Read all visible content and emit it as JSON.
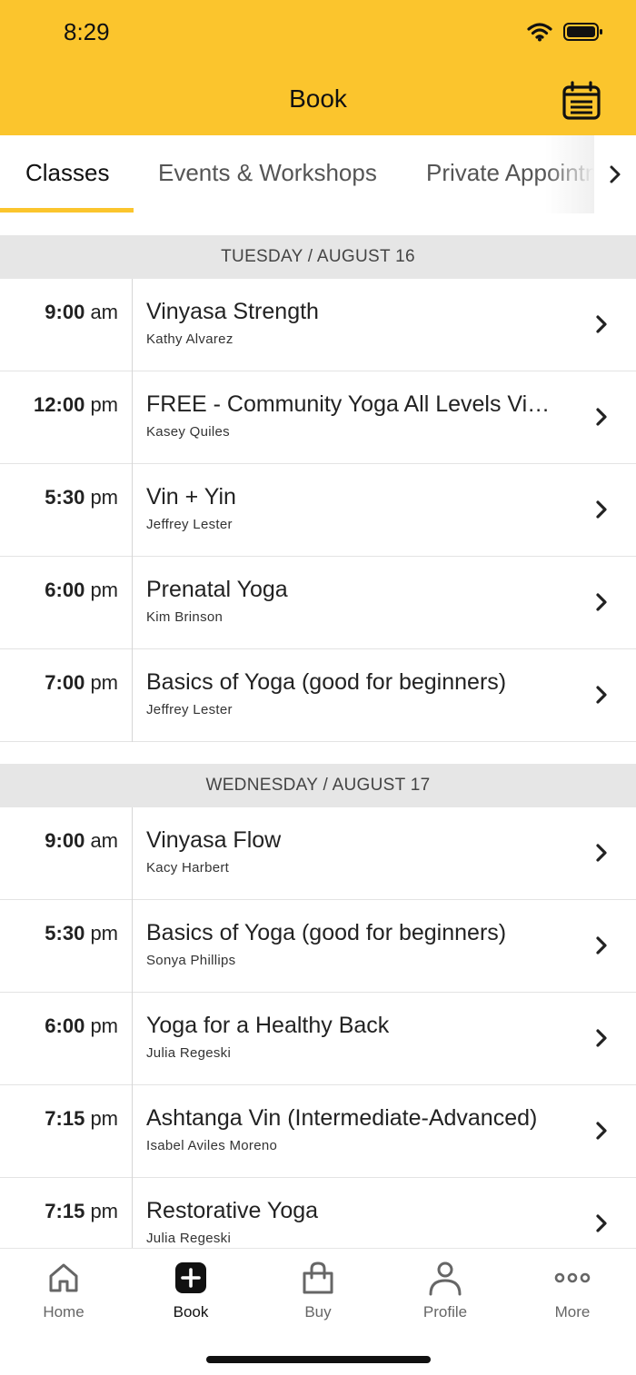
{
  "status": {
    "time": "8:29"
  },
  "header": {
    "title": "Book",
    "calendar_icon": "calendar-icon"
  },
  "tabs": [
    {
      "label": "Classes",
      "active": true
    },
    {
      "label": "Events & Workshops",
      "active": false
    },
    {
      "label": "Private Appointments",
      "active": false
    }
  ],
  "days": [
    {
      "header": "TUESDAY / AUGUST 16",
      "classes": [
        {
          "time": "9:00",
          "ampm": "am",
          "title": "Vinyasa Strength",
          "instructor": "Kathy Alvarez"
        },
        {
          "time": "12:00",
          "ampm": "pm",
          "title": "FREE - Community Yoga All Levels Vi…",
          "instructor": "Kasey Quiles"
        },
        {
          "time": "5:30",
          "ampm": "pm",
          "title": "Vin + Yin",
          "instructor": "Jeffrey Lester"
        },
        {
          "time": "6:00",
          "ampm": "pm",
          "title": "Prenatal Yoga",
          "instructor": "Kim Brinson"
        },
        {
          "time": "7:00",
          "ampm": "pm",
          "title": "Basics of Yoga (good for beginners)",
          "instructor": "Jeffrey Lester"
        }
      ]
    },
    {
      "header": "WEDNESDAY / AUGUST 17",
      "classes": [
        {
          "time": "9:00",
          "ampm": "am",
          "title": "Vinyasa Flow",
          "instructor": "Kacy Harbert"
        },
        {
          "time": "5:30",
          "ampm": "pm",
          "title": "Basics of Yoga (good for beginners)",
          "instructor": "Sonya Phillips"
        },
        {
          "time": "6:00",
          "ampm": "pm",
          "title": "Yoga for a Healthy Back",
          "instructor": "Julia Regeski"
        },
        {
          "time": "7:15",
          "ampm": "pm",
          "title": "Ashtanga Vin (Intermediate-Advanced)",
          "instructor": "Isabel Aviles Moreno"
        },
        {
          "time": "7:15",
          "ampm": "pm",
          "title": "Restorative Yoga",
          "instructor": "Julia Regeski"
        }
      ]
    }
  ],
  "bottom_nav": [
    {
      "label": "Home",
      "icon": "home-icon",
      "active": false
    },
    {
      "label": "Book",
      "icon": "plus-square-icon",
      "active": true
    },
    {
      "label": "Buy",
      "icon": "shopping-bag-icon",
      "active": false
    },
    {
      "label": "Profile",
      "icon": "person-icon",
      "active": false
    },
    {
      "label": "More",
      "icon": "more-dots-icon",
      "active": false
    }
  ],
  "colors": {
    "brand": "#FBC52D",
    "day_header_bg": "#E6E6E6",
    "text": "#222222"
  }
}
